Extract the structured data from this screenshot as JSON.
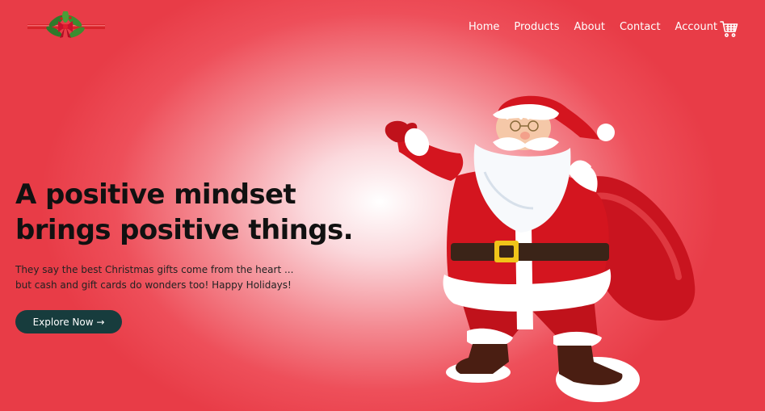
{
  "brand": {
    "logo_icon": "holly-bow-logo-icon"
  },
  "nav": {
    "items": [
      {
        "label": "Home"
      },
      {
        "label": "Products"
      },
      {
        "label": "About"
      },
      {
        "label": "Contact"
      },
      {
        "label": "Account"
      }
    ],
    "cart_icon": "shopping-cart-icon"
  },
  "hero": {
    "headline_line1": "A positive mindset",
    "headline_line2": "brings positive things.",
    "subtext_line1": "They say the best Christmas gifts come from the heart ...",
    "subtext_line2": "but cash and gift cards do wonders too! Happy Holidays!",
    "cta_label": "Explore Now →",
    "image_icon": "santa-claus-illustration"
  },
  "colors": {
    "background_red": "#e83c47",
    "button_dark_teal": "#173c3d",
    "nav_text": "#ffffff",
    "headline_text": "#111111"
  }
}
